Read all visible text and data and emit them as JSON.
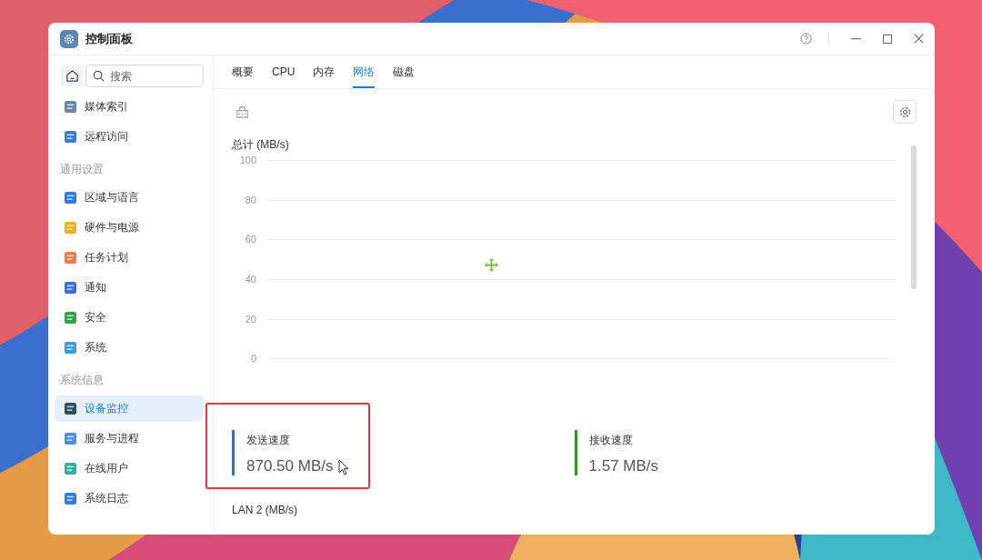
{
  "window": {
    "title": "控制面板"
  },
  "sidebar": {
    "search": {
      "placeholder": "搜索"
    },
    "sections": [
      {
        "items": [
          {
            "label": "媒体索引",
            "selected": false
          },
          {
            "label": "远程访问",
            "selected": false
          }
        ]
      },
      {
        "header": "通用设置",
        "items": [
          {
            "label": "区域与语言",
            "selected": false
          },
          {
            "label": "硬件与电源",
            "selected": false
          },
          {
            "label": "任务计划",
            "selected": false
          },
          {
            "label": "通知",
            "selected": false
          },
          {
            "label": "安全",
            "selected": false
          },
          {
            "label": "系统",
            "selected": false
          }
        ]
      },
      {
        "header": "系统信息",
        "items": [
          {
            "label": "设备监控",
            "selected": true
          },
          {
            "label": "服务与进程",
            "selected": false
          },
          {
            "label": "在线用户",
            "selected": false
          },
          {
            "label": "系统日志",
            "selected": false
          }
        ]
      }
    ]
  },
  "tabs": [
    {
      "label": "概要",
      "selected": false
    },
    {
      "label": "CPU",
      "selected": false
    },
    {
      "label": "内存",
      "selected": false
    },
    {
      "label": "网络",
      "selected": true
    },
    {
      "label": "磁盘",
      "selected": false
    }
  ],
  "total_chart": {
    "title": "总计 (MB/s)",
    "axis_labels": [
      "100",
      "80",
      "60",
      "40",
      "20",
      "0"
    ]
  },
  "stats": [
    {
      "label": "发送速度",
      "value": "870.50 MB/s",
      "color": "#1a73e8",
      "highlighted": true
    },
    {
      "label": "接收速度",
      "value": "1.57 MB/s",
      "color": "#2a9a1a",
      "highlighted": false
    }
  ],
  "lan_chart": {
    "title": "LAN 2 (MB/s)"
  }
}
